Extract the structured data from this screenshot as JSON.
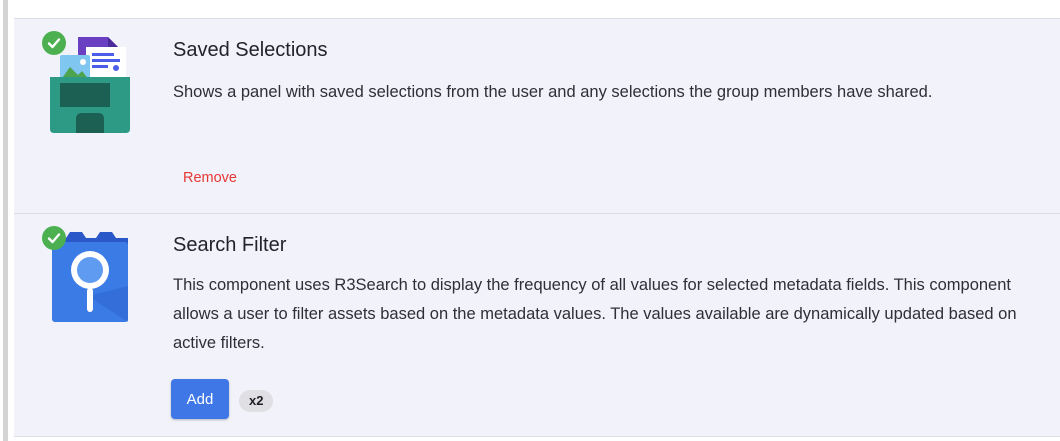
{
  "components": [
    {
      "title": "Saved Selections",
      "description": "Shows a panel with saved selections from the user and any selections the group members have shared.",
      "installed": true,
      "action_label": "Remove",
      "icon": "folder-with-images-icon"
    },
    {
      "title": "Search Filter",
      "description": "This component uses R3Search to display the frequency of all values for selected metadata fields. This component allows a user to filter assets based on the metadata values. The values available are dynamically updated based on active filters.",
      "installed": true,
      "action_label": "Add",
      "count_badge": "x2",
      "icon": "folder-with-magnifier-icon"
    }
  ],
  "colors": {
    "card_background": "#f1f2fa",
    "check_green": "#4caf50",
    "remove_red": "#e53935",
    "add_blue": "#3f78e6"
  }
}
